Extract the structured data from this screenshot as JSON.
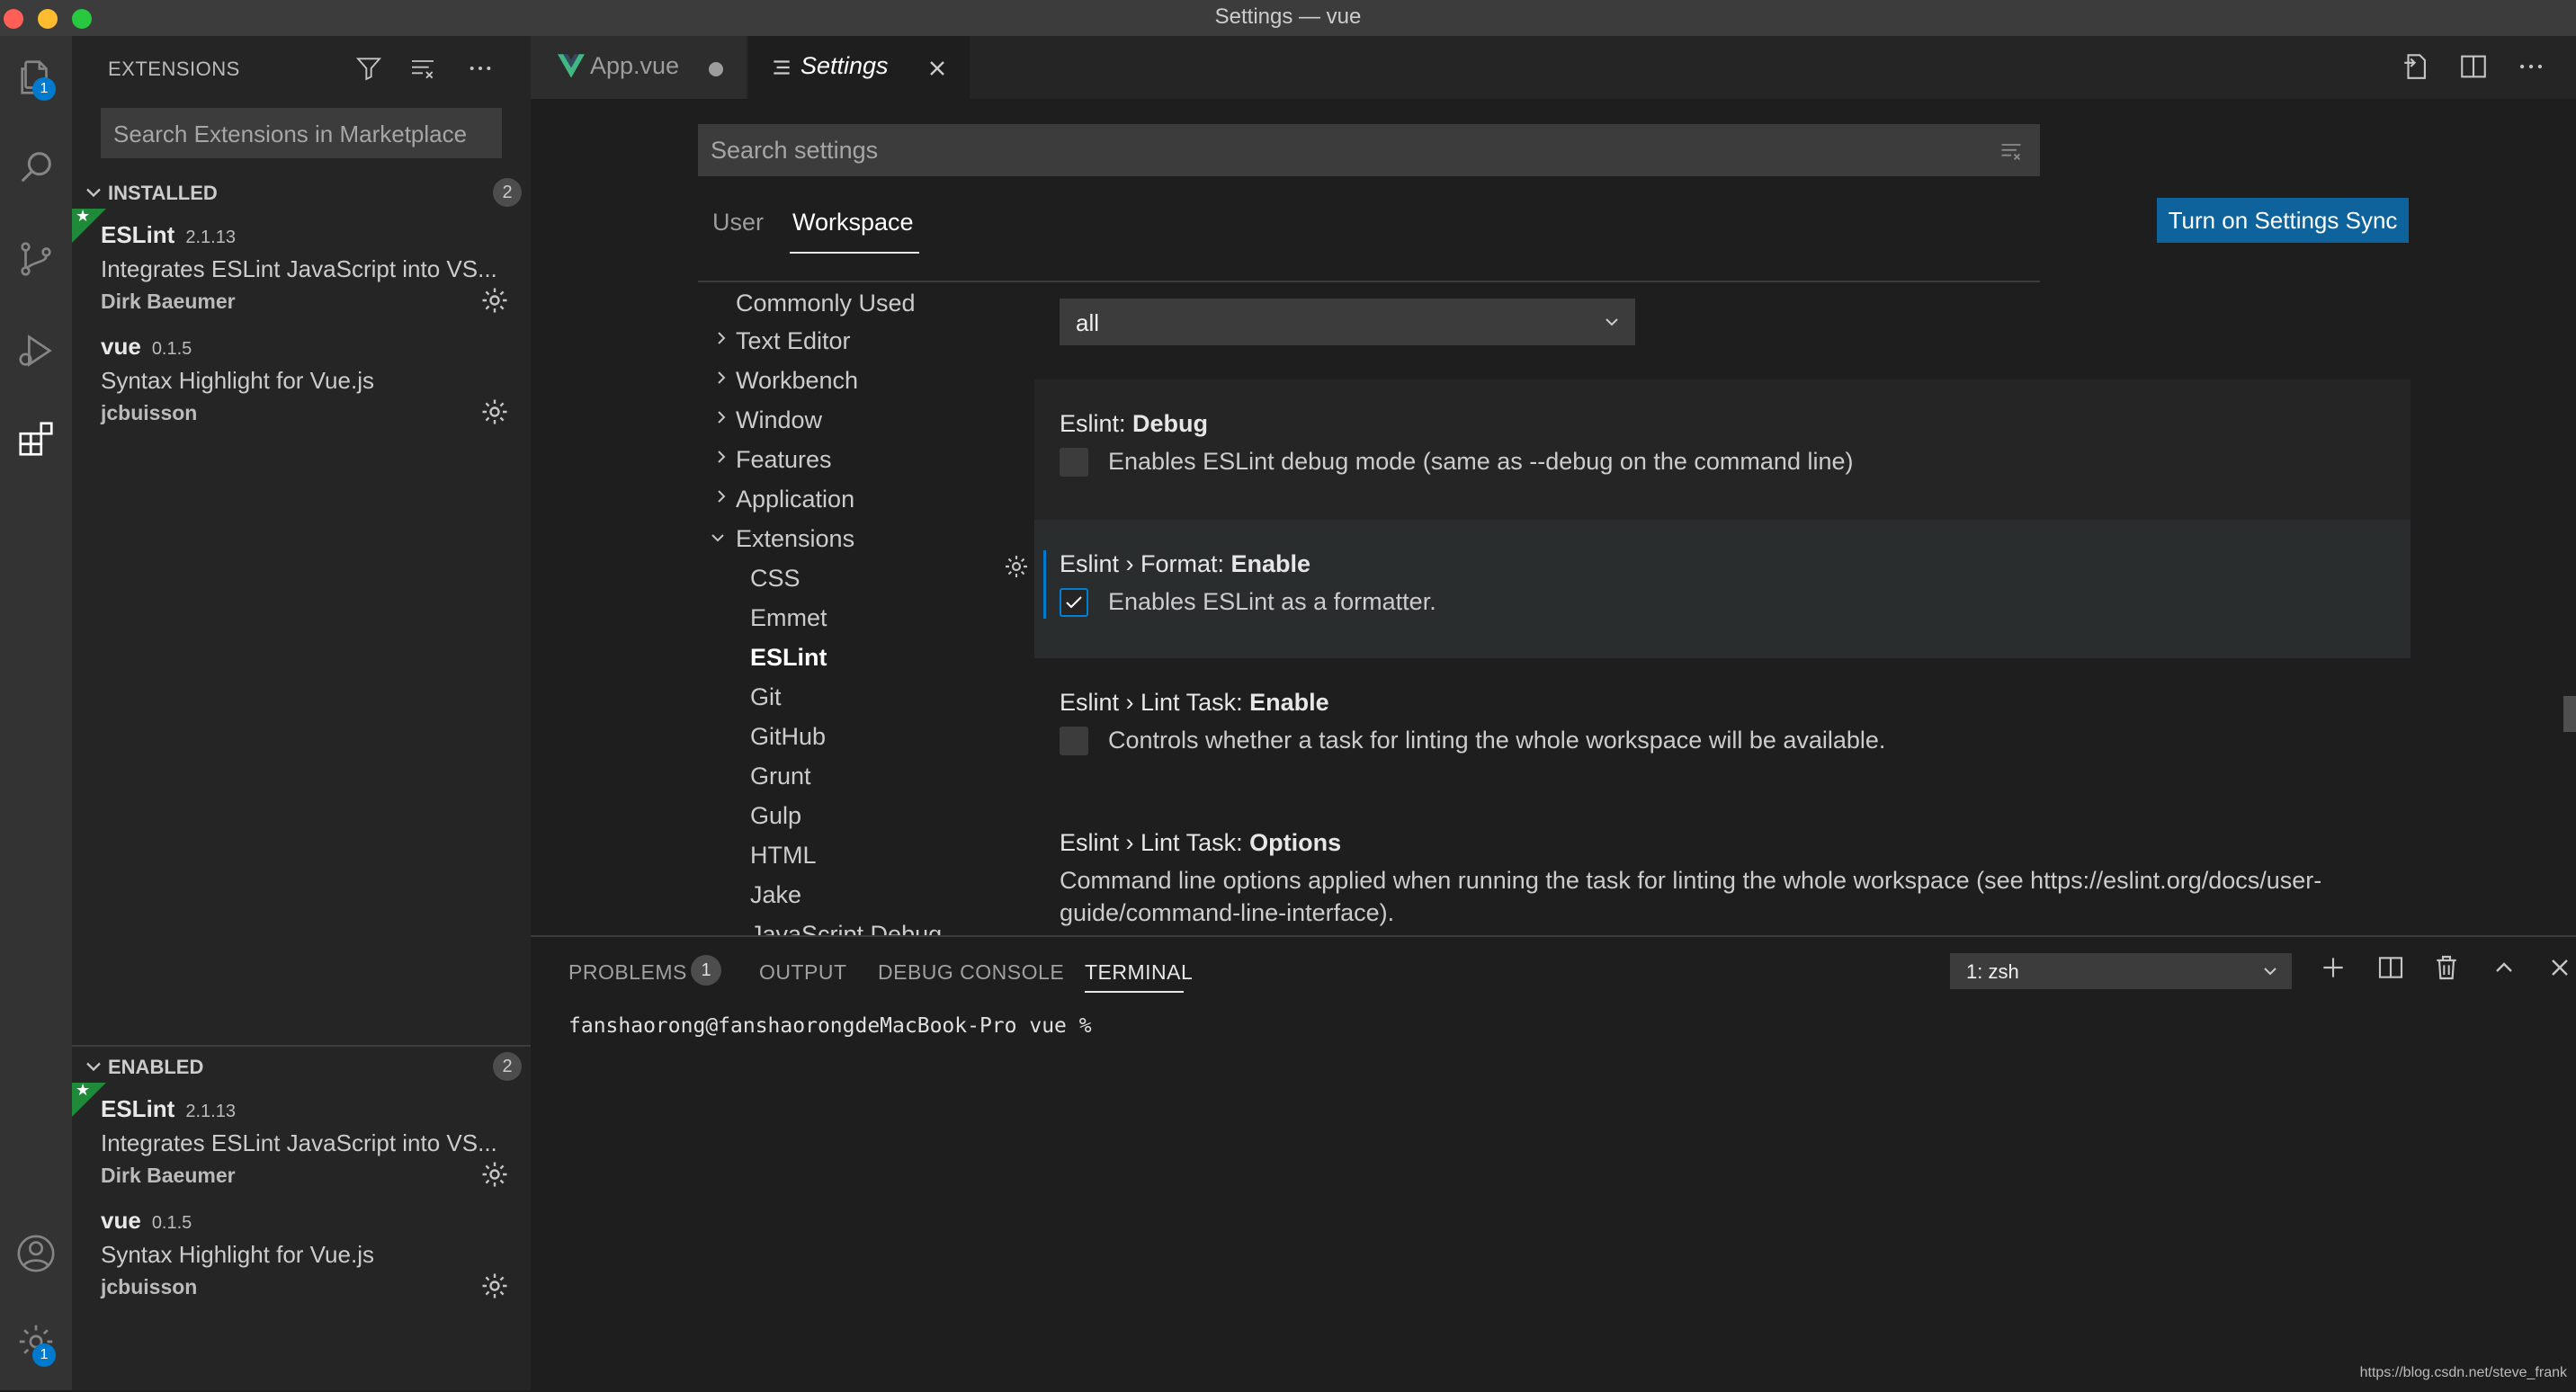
{
  "window": {
    "title": "Settings — vue",
    "traffic_colors": [
      "#ff5f57",
      "#febc2e",
      "#28c840"
    ]
  },
  "activity_bar": {
    "items": [
      {
        "icon": "files-icon",
        "badge": "1"
      },
      {
        "icon": "search-icon"
      },
      {
        "icon": "source-control-icon"
      },
      {
        "icon": "run-debug-icon"
      },
      {
        "icon": "extensions-icon"
      }
    ],
    "bottom": [
      {
        "icon": "account-icon"
      },
      {
        "icon": "manage-gear-icon",
        "badge": "1"
      }
    ]
  },
  "sidebar": {
    "title": "EXTENSIONS",
    "search_placeholder": "Search Extensions in Marketplace",
    "installed": {
      "label": "INSTALLED",
      "count": "2",
      "items": [
        {
          "name": "ESLint",
          "version": "2.1.13",
          "description": "Integrates ESLint JavaScript into VS...",
          "author": "Dirk Baeumer",
          "starred": true
        },
        {
          "name": "vue",
          "version": "0.1.5",
          "description": "Syntax Highlight for Vue.js",
          "author": "jcbuisson",
          "starred": false
        }
      ]
    },
    "enabled": {
      "label": "ENABLED",
      "count": "2",
      "items": [
        {
          "name": "ESLint",
          "version": "2.1.13",
          "description": "Integrates ESLint JavaScript into VS...",
          "author": "Dirk Baeumer",
          "starred": true
        },
        {
          "name": "vue",
          "version": "0.1.5",
          "description": "Syntax Highlight for Vue.js",
          "author": "jcbuisson",
          "starred": false
        }
      ]
    }
  },
  "tabs": [
    {
      "label": "App.vue",
      "dirty": true,
      "active": false
    },
    {
      "label": "Settings",
      "active": true
    }
  ],
  "settings": {
    "search_placeholder": "Search settings",
    "scope_tabs": [
      "User",
      "Workspace"
    ],
    "active_scope": "Workspace",
    "sync_button": "Turn on Settings Sync",
    "toc": {
      "top": [
        "Commonly Used",
        "Text Editor",
        "Workbench",
        "Window",
        "Features",
        "Application",
        "Extensions"
      ],
      "extensions": [
        "CSS",
        "Emmet",
        "ESLint",
        "Git",
        "GitHub",
        "Grunt",
        "Gulp",
        "HTML",
        "Jake",
        "JavaScript Debug"
      ],
      "active": "ESLint"
    },
    "select_value": "all",
    "items": [
      {
        "category": "Eslint: ",
        "name": "Debug",
        "description": "Enables ESLint debug mode (same as --debug on the command line)",
        "checked": false
      },
      {
        "category": "Eslint › Format: ",
        "name": "Enable",
        "description": "Enables ESLint as a formatter.",
        "checked": true
      },
      {
        "category": "Eslint › Lint Task: ",
        "name": "Enable",
        "description": "Controls whether a task for linting the whole workspace will be available.",
        "checked": false
      },
      {
        "category": "Eslint › Lint Task: ",
        "name": "Options",
        "description_line1": "Command line options applied when running the task for linting the whole workspace (see https://eslint.org/docs/user-",
        "description_line2": "guide/command-line-interface)."
      }
    ]
  },
  "panel": {
    "tabs": [
      "PROBLEMS",
      "OUTPUT",
      "DEBUG CONSOLE",
      "TERMINAL"
    ],
    "problems_count": "1",
    "active_tab": "TERMINAL",
    "terminal_select": "1: zsh",
    "terminal_line": "fanshaorong@fanshaorongdeMacBook-Pro vue %"
  },
  "watermark": "https://blog.csdn.net/steve_frank",
  "colors": {
    "accent": "#007acc",
    "sync_button": "#0e639c",
    "vue_green": "#41b883",
    "star_ribbon": "#1e8a3a"
  }
}
